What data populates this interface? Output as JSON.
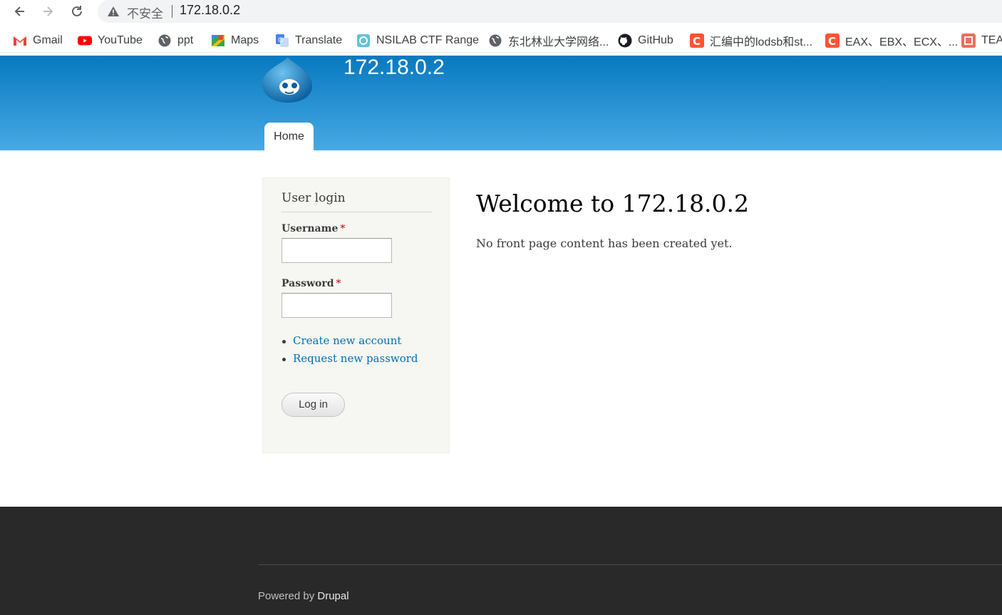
{
  "browser": {
    "security_label": "不安全",
    "url": "172.18.0.2",
    "bookmarks": [
      {
        "label": "Gmail",
        "icon": "gmail-icon"
      },
      {
        "label": "YouTube",
        "icon": "youtube-icon"
      },
      {
        "label": "ppt",
        "icon": "globe-icon"
      },
      {
        "label": "Maps",
        "icon": "maps-icon"
      },
      {
        "label": "Translate",
        "icon": "translate-icon"
      },
      {
        "label": "NSILAB CTF Range",
        "icon": "nsilab-icon"
      },
      {
        "label": "东北林业大学网络...",
        "icon": "globe-icon"
      },
      {
        "label": "GitHub",
        "icon": "github-icon"
      },
      {
        "label": "汇编中的lodsb和st...",
        "icon": "csdn-icon"
      },
      {
        "label": "EAX、EBX、ECX、...",
        "icon": "csdn-icon"
      },
      {
        "label": "TEA",
        "icon": "jianshu-icon"
      }
    ]
  },
  "site": {
    "name": "172.18.0.2",
    "nav": {
      "home": "Home"
    },
    "colors": {
      "header_top": "#0779bf",
      "header_bottom": "#48a9e4",
      "link": "#0071b3",
      "footer": "#292929"
    }
  },
  "login": {
    "title": "User login",
    "username_label": "Username",
    "password_label": "Password",
    "required_mark": "*",
    "username_value": "",
    "password_value": "",
    "links": [
      "Create new account",
      "Request new password"
    ],
    "submit": "Log in"
  },
  "main": {
    "title": "Welcome to 172.18.0.2",
    "text": "No front page content has been created yet."
  },
  "footer": {
    "prefix": "Powered by",
    "link": "Drupal"
  }
}
